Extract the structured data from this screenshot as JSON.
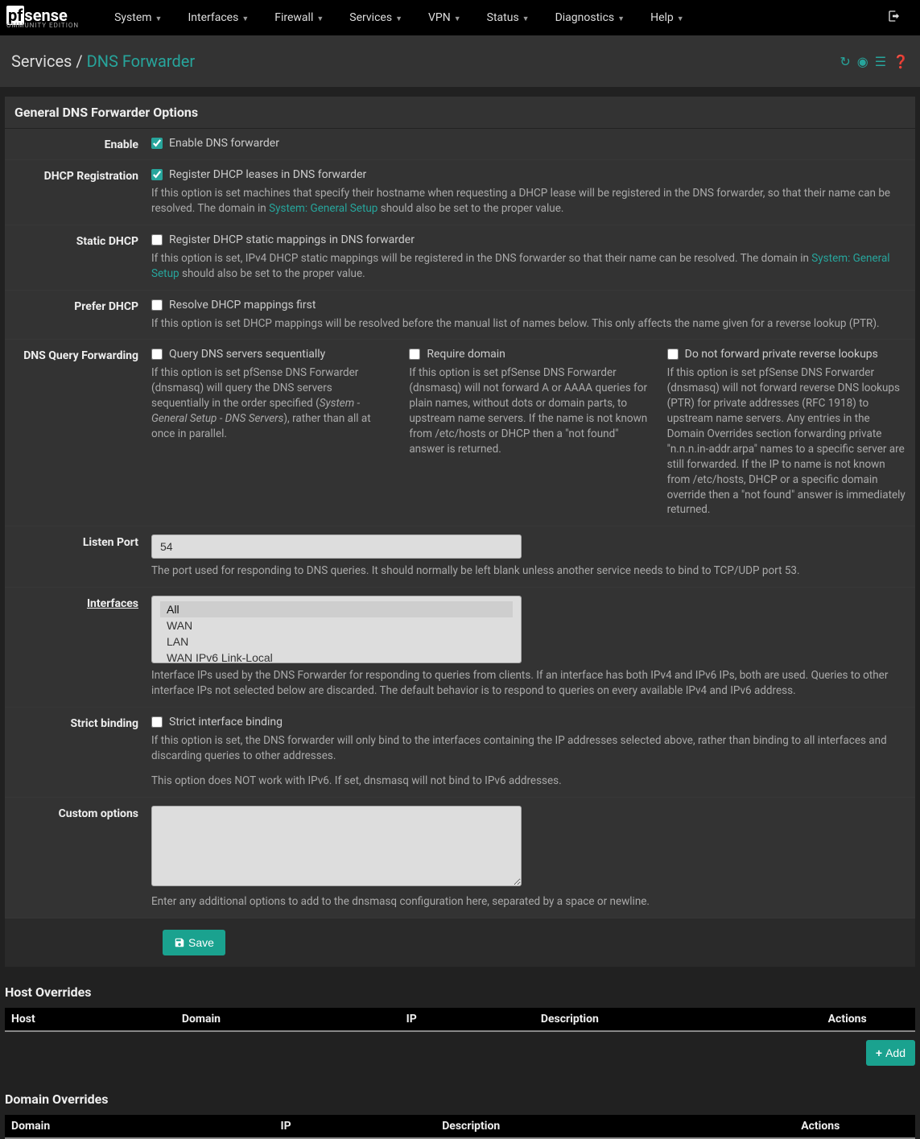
{
  "logo": {
    "brand_left": "pf",
    "brand_right": "sense",
    "edition": "ommunity Edition"
  },
  "nav": [
    "System",
    "Interfaces",
    "Firewall",
    "Services",
    "VPN",
    "Status",
    "Diagnostics",
    "Help"
  ],
  "breadcrumb": {
    "parent": "Services",
    "sep": "/",
    "current": "DNS Forwarder"
  },
  "panel1": {
    "title": "General DNS Forwarder Options",
    "enable": {
      "label": "Enable",
      "check": "Enable DNS forwarder"
    },
    "dhcp_reg": {
      "label": "DHCP Registration",
      "check": "Register DHCP leases in DNS forwarder",
      "help_a": "If this option is set machines that specify their hostname when requesting a DHCP lease will be registered in the DNS forwarder, so that their name can be resolved. The domain in ",
      "link": "System: General Setup",
      "help_b": " should also be set to the proper value."
    },
    "static_dhcp": {
      "label": "Static DHCP",
      "check": "Register DHCP static mappings in DNS forwarder",
      "help_a": "If this option is set, IPv4 DHCP static mappings will be registered in the DNS forwarder so that their name can be resolved. The domain in ",
      "link": "System: General Setup",
      "help_b": " should also be set to the proper value."
    },
    "prefer_dhcp": {
      "label": "Prefer DHCP",
      "check": "Resolve DHCP mappings first",
      "help": "If this option is set DHCP mappings will be resolved before the manual list of names below. This only affects the name given for a reverse lookup (PTR)."
    },
    "query_fwd": {
      "label": "DNS Query Forwarding",
      "c1": {
        "check": "Query DNS servers sequentially",
        "help_a": "If this option is set pfSense DNS Forwarder (dnsmasq) will query the DNS servers sequentially in the order specified (",
        "italic": "System - General Setup - DNS Servers",
        "help_b": "), rather than all at once in parallel."
      },
      "c2": {
        "check": "Require domain",
        "help": "If this option is set pfSense DNS Forwarder (dnsmasq) will not forward A or AAAA queries for plain names, without dots or domain parts, to upstream name servers. If the name is not known from /etc/hosts or DHCP then a \"not found\" answer is returned."
      },
      "c3": {
        "check": "Do not forward private reverse lookups",
        "help": "If this option is set pfSense DNS Forwarder (dnsmasq) will not forward reverse DNS lookups (PTR) for private addresses (RFC 1918) to upstream name servers. Any entries in the Domain Overrides section forwarding private \"n.n.n.in-addr.arpa\" names to a specific server are still forwarded. If the IP to name is not known from /etc/hosts, DHCP or a specific domain override then a \"not found\" answer is immediately returned."
      }
    },
    "listen_port": {
      "label": "Listen Port",
      "value": "54",
      "help": "The port used for responding to DNS queries. It should normally be left blank unless another service needs to bind to TCP/UDP port 53."
    },
    "interfaces": {
      "label": "Interfaces",
      "opts": [
        "All",
        "WAN",
        "LAN",
        "WAN IPv6 Link-Local"
      ],
      "help": "Interface IPs used by the DNS Forwarder for responding to queries from clients. If an interface has both IPv4 and IPv6 IPs, both are used. Queries to other interface IPs not selected below are discarded. The default behavior is to respond to queries on every available IPv4 and IPv6 address."
    },
    "strict": {
      "label": "Strict binding",
      "check": "Strict interface binding",
      "help1": "If this option is set, the DNS forwarder will only bind to the interfaces containing the IP addresses selected above, rather than binding to all interfaces and discarding queries to other addresses.",
      "help2": "This option does NOT work with IPv6. If set, dnsmasq will not bind to IPv6 addresses."
    },
    "custom": {
      "label": "Custom options",
      "help": "Enter any additional options to add to the dnsmasq configuration here, separated by a space or newline."
    },
    "save": "Save"
  },
  "host_ov": {
    "title": "Host Overrides",
    "cols": [
      "Host",
      "Domain",
      "IP",
      "Description",
      "Actions"
    ],
    "add": "Add"
  },
  "domain_ov": {
    "title": "Domain Overrides",
    "cols": [
      "Domain",
      "IP",
      "Description",
      "Actions"
    ]
  }
}
